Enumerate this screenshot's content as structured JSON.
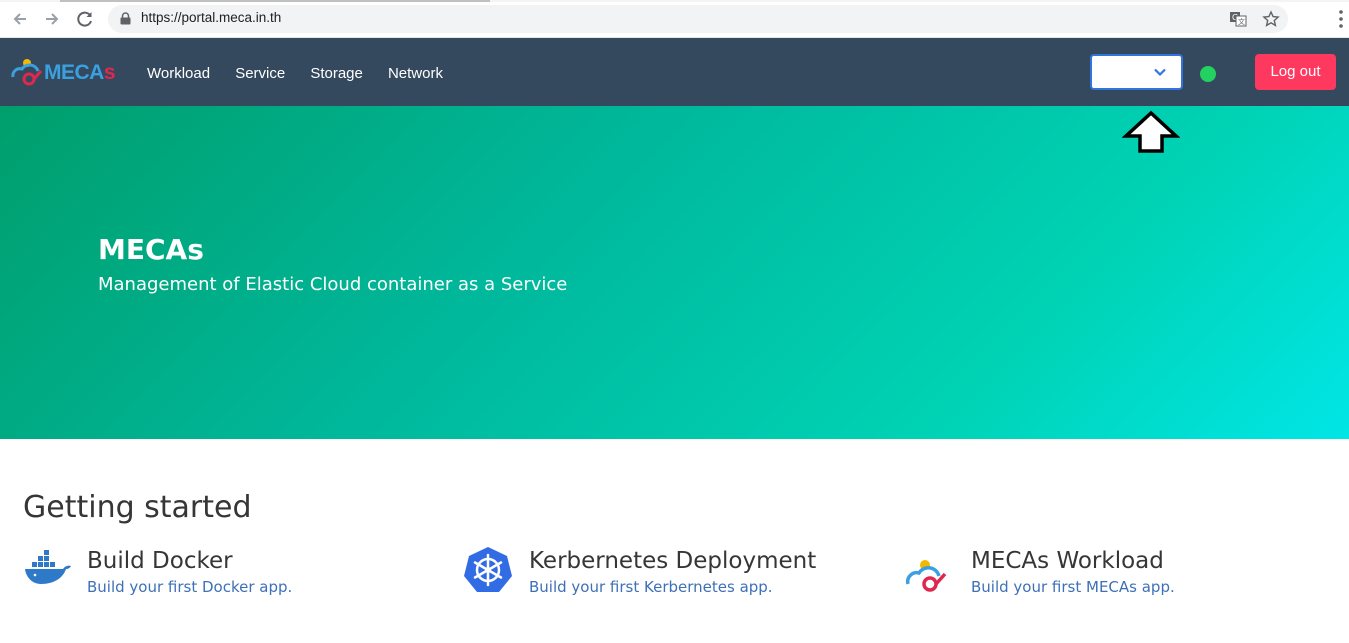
{
  "browser": {
    "url": "https://portal.meca.in.th",
    "back_icon": "arrow-left-icon",
    "forward_icon": "arrow-right-icon",
    "reload_icon": "reload-icon",
    "translate_icon": "translate-icon",
    "bookmark_icon": "star-icon",
    "menu_icon": "kebab-menu-icon"
  },
  "navbar": {
    "logo_text": "MECAs",
    "links": [
      "Workload",
      "Service",
      "Storage",
      "Network"
    ],
    "select_value": "",
    "logout_label": "Log out",
    "colors": {
      "bg": "#34495e",
      "status": "#23d160",
      "logout": "#ff3860",
      "select_border": "#3273dc"
    }
  },
  "hero": {
    "title": "MECAs",
    "subtitle": "Management of Elastic Cloud container as a Service"
  },
  "getting_started": {
    "heading": "Getting started",
    "cards": [
      {
        "icon": "docker-whale-icon",
        "title": "Build Docker",
        "subtitle": "Build your first Docker app."
      },
      {
        "icon": "kubernetes-helm-icon",
        "title": "Kerbernetes Deployment",
        "subtitle": "Build your first Kerbernetes app."
      },
      {
        "icon": "mecas-cloud-icon",
        "title": "MECAs Workload",
        "subtitle": "Build your first MECAs app."
      }
    ]
  }
}
